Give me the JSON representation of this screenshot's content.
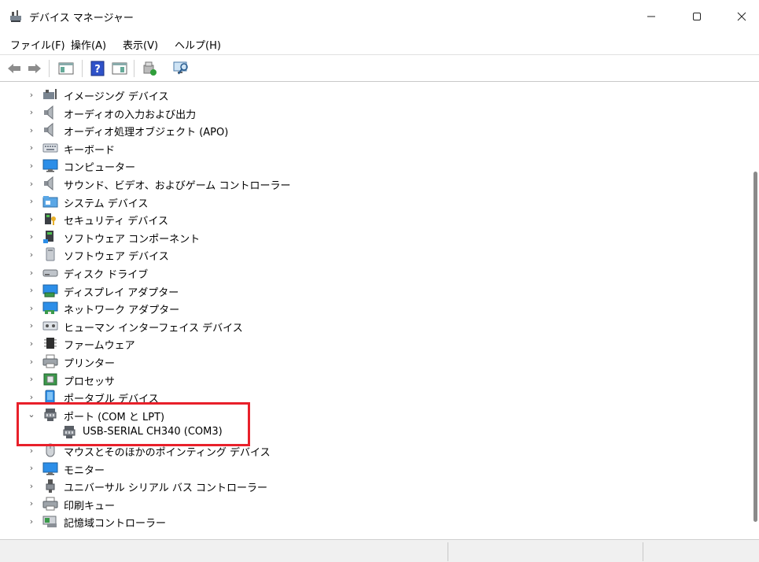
{
  "window": {
    "title": "デバイス マネージャー",
    "icons": {
      "app": "device-manager-icon",
      "minimize": "minimize-icon",
      "maximize": "maximize-icon",
      "close": "close-icon"
    }
  },
  "menu": {
    "items": [
      "ファイル(F)",
      "操作(A)",
      "表示(V)",
      "ヘルプ(H)"
    ]
  },
  "toolbar": {
    "buttons": [
      "back-icon",
      "forward-icon",
      "show-hide-console-tree-icon",
      "help-icon",
      "properties-icon",
      "update-driver-icon",
      "scan-hardware-icon"
    ]
  },
  "tree": {
    "categories": [
      {
        "label": "イメージング デバイス",
        "icon": "camera-icon",
        "expanded": false
      },
      {
        "label": "オーディオの入力および出力",
        "icon": "speaker-icon",
        "expanded": false
      },
      {
        "label": "オーディオ処理オブジェクト (APO)",
        "icon": "speaker-icon",
        "expanded": false
      },
      {
        "label": "キーボード",
        "icon": "keyboard-icon",
        "expanded": false
      },
      {
        "label": "コンピューター",
        "icon": "monitor-icon",
        "expanded": false
      },
      {
        "label": "サウンド、ビデオ、およびゲーム コントローラー",
        "icon": "speaker-icon",
        "expanded": false
      },
      {
        "label": "システム デバイス",
        "icon": "system-folder-icon",
        "expanded": false
      },
      {
        "label": "セキュリティ デバイス",
        "icon": "security-key-icon",
        "expanded": false
      },
      {
        "label": "ソフトウェア コンポーネント",
        "icon": "software-component-icon",
        "expanded": false
      },
      {
        "label": "ソフトウェア デバイス",
        "icon": "software-device-icon",
        "expanded": false
      },
      {
        "label": "ディスク ドライブ",
        "icon": "disk-drive-icon",
        "expanded": false
      },
      {
        "label": "ディスプレイ アダプター",
        "icon": "display-adapter-icon",
        "expanded": false
      },
      {
        "label": "ネットワーク アダプター",
        "icon": "network-adapter-icon",
        "expanded": false
      },
      {
        "label": "ヒューマン インターフェイス デバイス",
        "icon": "hid-icon",
        "expanded": false
      },
      {
        "label": "ファームウェア",
        "icon": "firmware-chip-icon",
        "expanded": false
      },
      {
        "label": "プリンター",
        "icon": "printer-icon",
        "expanded": false
      },
      {
        "label": "プロセッサ",
        "icon": "processor-icon",
        "expanded": false
      },
      {
        "label": "ポータブル デバイス",
        "icon": "portable-device-icon",
        "expanded": false
      },
      {
        "label": "ポート (COM と LPT)",
        "icon": "port-connector-icon",
        "expanded": true,
        "children": [
          {
            "label": "USB-SERIAL CH340 (COM3)",
            "icon": "port-connector-icon"
          }
        ]
      },
      {
        "label": "マウスとそのほかのポインティング デバイス",
        "icon": "mouse-icon",
        "expanded": false
      },
      {
        "label": "モニター",
        "icon": "monitor-icon",
        "expanded": false
      },
      {
        "label": "ユニバーサル シリアル バス コントローラー",
        "icon": "usb-icon",
        "expanded": false
      },
      {
        "label": "印刷キュー",
        "icon": "printer-icon",
        "expanded": false
      },
      {
        "label": "記憶域コントローラー",
        "icon": "storage-controller-icon",
        "expanded": false
      }
    ]
  },
  "colors": {
    "highlight": "#e8202a",
    "accent": "#1e6fd9"
  }
}
